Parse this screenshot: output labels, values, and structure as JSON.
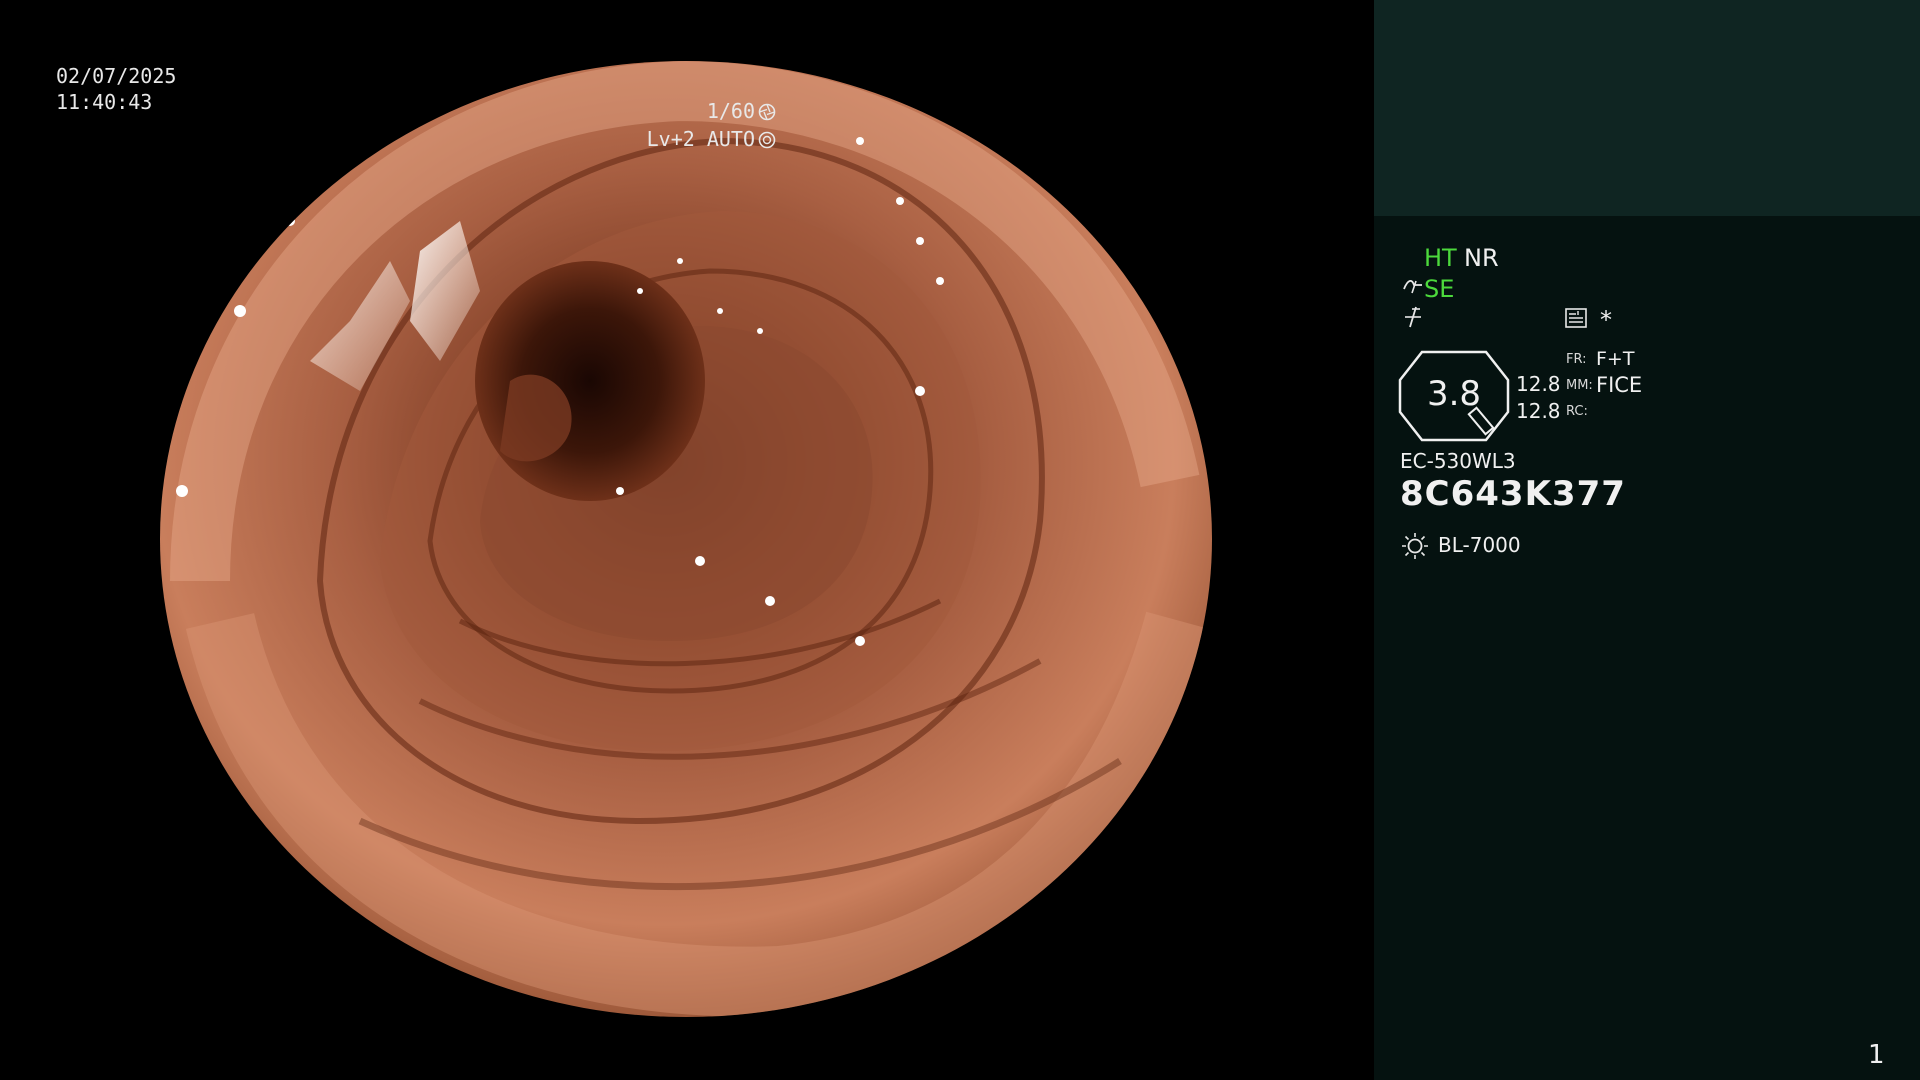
{
  "overlay": {
    "date": "02/07/2025",
    "time": "11:40:43",
    "shutter": "1/60",
    "level": "Lv+2 AUTO"
  },
  "panel": {
    "ht": "HT",
    "nr": "NR",
    "se": "SE",
    "zoom": "3.8",
    "val1": "12.8",
    "val2": "12.8",
    "fr_label": "FR:",
    "fr_value": "F+T",
    "mm_label": "MM:",
    "mm_value": "FICE",
    "rc_label": "RC:",
    "scope_model": "EC-530WL3",
    "serial": "8C643K377",
    "light_source": "BL-7000",
    "star": "*",
    "page_number": "1"
  },
  "colors": {
    "active_green": "#4cd93c",
    "panel_bg": "#051210",
    "panel_top_bg": "#0f2522"
  },
  "icons": [
    "shutter-aperture-icon",
    "auto-iris-icon",
    "structure-enhance-icon",
    "signal-icon",
    "memory-icon",
    "light-source-icon"
  ]
}
